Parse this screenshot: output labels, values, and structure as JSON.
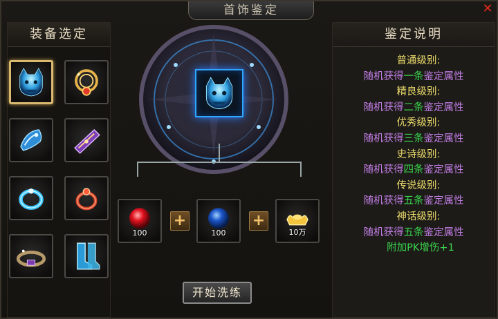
{
  "window": {
    "title": "首饰鉴定"
  },
  "left": {
    "header": "装备选定",
    "items": [
      {
        "icon": "blue-wolf-helmet-icon",
        "selected": true
      },
      {
        "icon": "gold-necklace-icon",
        "selected": false
      },
      {
        "icon": "blue-bracelet-icon",
        "selected": false
      },
      {
        "icon": "purple-bracelet-icon",
        "selected": false
      },
      {
        "icon": "blue-ring-icon",
        "selected": false
      },
      {
        "icon": "red-ring-icon",
        "selected": false
      },
      {
        "icon": "purple-belt-icon",
        "selected": false
      },
      {
        "icon": "blue-boots-icon",
        "selected": false
      }
    ]
  },
  "center": {
    "target_icon": "blue-wolf-helmet-icon",
    "materials": [
      {
        "icon": "red-gem-icon",
        "count": "100"
      },
      {
        "icon": "blue-gem-icon",
        "count": "100"
      },
      {
        "icon": "gold-ingot-icon",
        "count": "10万"
      }
    ],
    "plus_symbol": "+",
    "start_button": "开始洗练"
  },
  "right": {
    "header": "鉴定说明",
    "levels": [
      {
        "name": "普通级别:",
        "pre": "随机获得",
        "num": "一条",
        "post": "鉴定属性"
      },
      {
        "name": "精良级别:",
        "pre": "随机获得",
        "num": "二条",
        "post": "鉴定属性"
      },
      {
        "name": "优秀级别:",
        "pre": "随机获得",
        "num": "三条",
        "post": "鉴定属性"
      },
      {
        "name": "史诗级别:",
        "pre": "随机获得",
        "num": "四条",
        "post": "鉴定属性"
      },
      {
        "name": "传说级别:",
        "pre": "随机获得",
        "num": "五条",
        "post": "鉴定属性"
      },
      {
        "name": "神话级别:",
        "pre": "随机获得",
        "num": "五条",
        "post": "鉴定属性"
      }
    ],
    "extra": "附加PK增伤+1"
  },
  "colors": {
    "accent_gold": "#d9b870",
    "highlight_green": "#39d64d",
    "desc_purple": "#c27ee6",
    "level_yellow": "#e8d86a",
    "target_blue": "#2fa6ff"
  }
}
